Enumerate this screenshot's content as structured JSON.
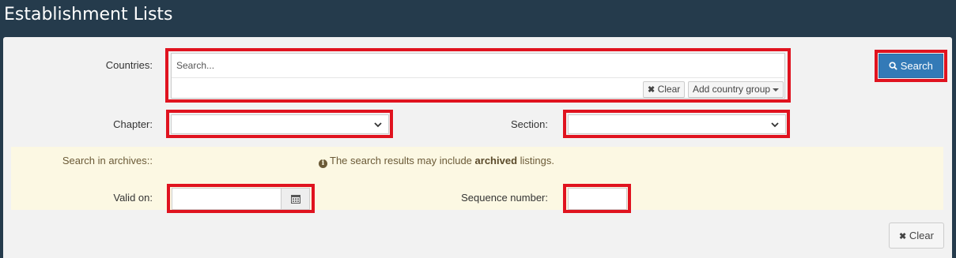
{
  "header": {
    "title": "Establishment Lists"
  },
  "form": {
    "countries": {
      "label": "Countries:",
      "placeholder": "Search...",
      "clear_label": "Clear",
      "add_group_label": "Add country group"
    },
    "chapter": {
      "label": "Chapter:",
      "value": ""
    },
    "section": {
      "label": "Section:",
      "value": ""
    },
    "archives": {
      "label": "Search in archives::",
      "notice_prefix": "The search results may include ",
      "notice_bold": "archived",
      "notice_suffix": " listings."
    },
    "valid_on": {
      "label": "Valid on:",
      "value": ""
    },
    "sequence": {
      "label": "Sequence number:",
      "value": ""
    }
  },
  "actions": {
    "search_label": "Search",
    "clear_label": "Clear"
  },
  "colors": {
    "header_bg": "#253b4c",
    "primary": "#337ab7",
    "highlight": "#e0131f",
    "warning_bg": "#fcf8e3"
  },
  "icons": {
    "search": "search-icon",
    "clear": "times-icon",
    "dropdown": "chevron-down-icon",
    "calendar": "calendar-icon",
    "info": "info-icon"
  }
}
